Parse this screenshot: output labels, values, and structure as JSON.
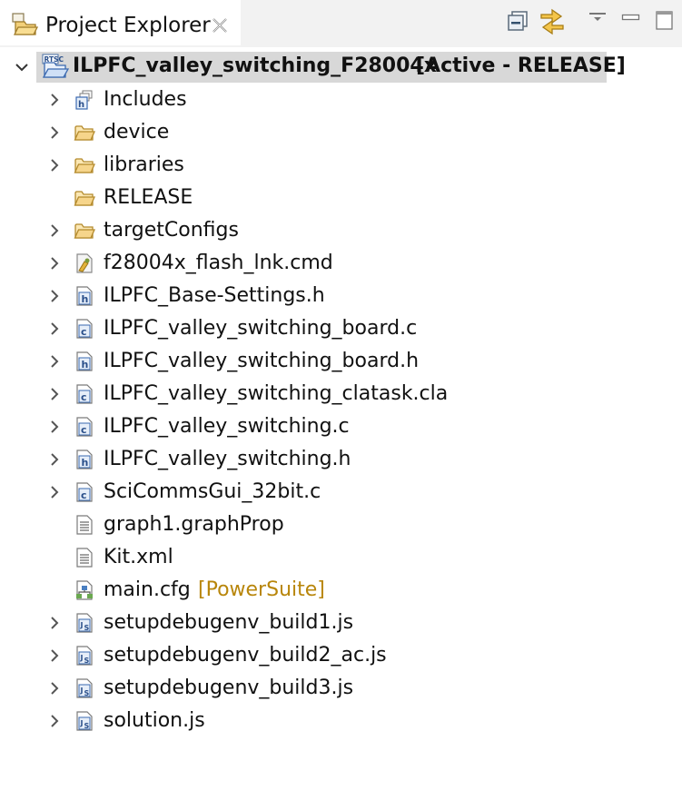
{
  "view": {
    "title": "Project Explorer",
    "toolbar": {
      "collapse_all_icon": "collapse-all-icon",
      "link_editor_icon": "link-with-editor-icon",
      "view_menu_icon": "view-menu-icon",
      "minimize_icon": "minimize-icon",
      "maximize_icon": "maximize-icon"
    }
  },
  "tree": {
    "root": {
      "name": "ILPFC_valley_switching_F28004x",
      "status": "[Active - RELEASE]",
      "icon": "rtsc-project-icon",
      "expanded": true
    },
    "items": [
      {
        "label": "Includes",
        "icon": "includes-icon",
        "expandable": true
      },
      {
        "label": "device",
        "icon": "folder-icon",
        "expandable": true
      },
      {
        "label": "libraries",
        "icon": "folder-icon",
        "expandable": true
      },
      {
        "label": "RELEASE",
        "icon": "folder-icon",
        "expandable": false
      },
      {
        "label": "targetConfigs",
        "icon": "folder-icon",
        "expandable": true
      },
      {
        "label": "f28004x_flash_lnk.cmd",
        "icon": "linker-cmd-icon",
        "expandable": true
      },
      {
        "label": "ILPFC_Base-Settings.h",
        "icon": "header-file-icon",
        "expandable": true
      },
      {
        "label": "ILPFC_valley_switching_board.c",
        "icon": "c-file-icon",
        "expandable": true
      },
      {
        "label": "ILPFC_valley_switching_board.h",
        "icon": "header-file-icon",
        "expandable": true
      },
      {
        "label": "ILPFC_valley_switching_clatask.cla",
        "icon": "c-file-icon",
        "expandable": true
      },
      {
        "label": "ILPFC_valley_switching.c",
        "icon": "c-file-icon",
        "expandable": true
      },
      {
        "label": "ILPFC_valley_switching.h",
        "icon": "header-file-icon",
        "expandable": true
      },
      {
        "label": "SciCommsGui_32bit.c",
        "icon": "c-file-icon",
        "expandable": true
      },
      {
        "label": "graph1.graphProp",
        "icon": "text-file-icon",
        "expandable": false
      },
      {
        "label": "Kit.xml",
        "icon": "text-file-icon",
        "expandable": false
      },
      {
        "label": "main.cfg",
        "decoration": "[PowerSuite]",
        "icon": "config-file-icon",
        "expandable": false
      },
      {
        "label": "setupdebugenv_build1.js",
        "icon": "js-file-icon",
        "expandable": true
      },
      {
        "label": "setupdebugenv_build2_ac.js",
        "icon": "js-file-icon",
        "expandable": true
      },
      {
        "label": "setupdebugenv_build3.js",
        "icon": "js-file-icon",
        "expandable": true
      },
      {
        "label": "solution.js",
        "icon": "js-file-icon",
        "expandable": true
      }
    ]
  },
  "colors": {
    "selection": "#d8d8d8",
    "folder": "#e8b84a",
    "decoration": "#b8860b",
    "header_bg": "#f2f2f2"
  }
}
